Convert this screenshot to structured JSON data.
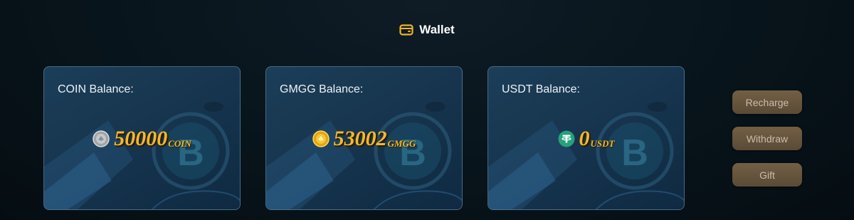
{
  "header": {
    "title": "Wallet",
    "icon": "wallet-icon",
    "icon_color": "#f0b429"
  },
  "cards": [
    {
      "label": "COIN Balance:",
      "amount": "50000",
      "unit": "COIN",
      "icon": "silver-coin-icon"
    },
    {
      "label": "GMGG Balance:",
      "amount": "53002",
      "unit": "GMGG",
      "icon": "gold-coin-icon"
    },
    {
      "label": "USDT Balance:",
      "amount": "0",
      "unit": "USDT",
      "icon": "tether-icon"
    }
  ],
  "actions": {
    "recharge": "Recharge",
    "withdraw": "Withdraw",
    "gift": "Gift"
  },
  "colors": {
    "amount": "#f5b828",
    "button_bg": "#735f45",
    "button_text": "#c9bdaa",
    "card_bg": "#1c3e58"
  }
}
